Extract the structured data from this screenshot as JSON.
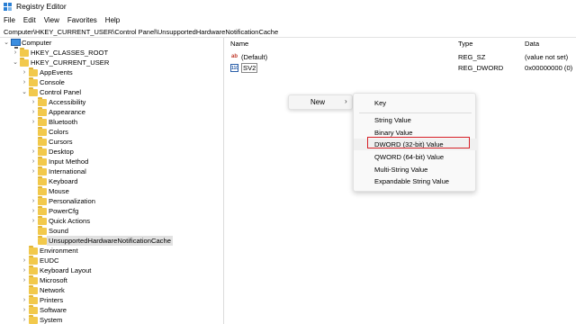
{
  "window": {
    "title": "Registry Editor"
  },
  "menu": [
    "File",
    "Edit",
    "View",
    "Favorites",
    "Help"
  ],
  "address": "Computer\\HKEY_CURRENT_USER\\Control Panel\\UnsupportedHardwareNotificationCache",
  "tree": [
    {
      "label": "Computer",
      "chev": "⌄",
      "icon": "pc",
      "depth": 0
    },
    {
      "label": "HKEY_CLASSES_ROOT",
      "chev": "›",
      "icon": "folder",
      "depth": 1
    },
    {
      "label": "HKEY_CURRENT_USER",
      "chev": "⌄",
      "icon": "folder",
      "depth": 1
    },
    {
      "label": "AppEvents",
      "chev": "›",
      "icon": "folder",
      "depth": 2
    },
    {
      "label": "Console",
      "chev": "›",
      "icon": "folder",
      "depth": 2
    },
    {
      "label": "Control Panel",
      "chev": "⌄",
      "icon": "folder",
      "depth": 2
    },
    {
      "label": "Accessibility",
      "chev": "›",
      "icon": "folder",
      "depth": 3
    },
    {
      "label": "Appearance",
      "chev": "›",
      "icon": "folder",
      "depth": 3
    },
    {
      "label": "Bluetooth",
      "chev": "›",
      "icon": "folder",
      "depth": 3
    },
    {
      "label": "Colors",
      "chev": "",
      "icon": "folder",
      "depth": 3
    },
    {
      "label": "Cursors",
      "chev": "",
      "icon": "folder",
      "depth": 3
    },
    {
      "label": "Desktop",
      "chev": "›",
      "icon": "folder",
      "depth": 3
    },
    {
      "label": "Input Method",
      "chev": "›",
      "icon": "folder",
      "depth": 3
    },
    {
      "label": "International",
      "chev": "›",
      "icon": "folder",
      "depth": 3
    },
    {
      "label": "Keyboard",
      "chev": "",
      "icon": "folder",
      "depth": 3
    },
    {
      "label": "Mouse",
      "chev": "",
      "icon": "folder",
      "depth": 3
    },
    {
      "label": "Personalization",
      "chev": "›",
      "icon": "folder",
      "depth": 3
    },
    {
      "label": "PowerCfg",
      "chev": "›",
      "icon": "folder",
      "depth": 3
    },
    {
      "label": "Quick Actions",
      "chev": "›",
      "icon": "folder",
      "depth": 3
    },
    {
      "label": "Sound",
      "chev": "",
      "icon": "folder",
      "depth": 3
    },
    {
      "label": "UnsupportedHardwareNotificationCache",
      "chev": "",
      "icon": "folder",
      "depth": 3,
      "selected": true
    },
    {
      "label": "Environment",
      "chev": "",
      "icon": "folder",
      "depth": 2
    },
    {
      "label": "EUDC",
      "chev": "›",
      "icon": "folder",
      "depth": 2
    },
    {
      "label": "Keyboard Layout",
      "chev": "›",
      "icon": "folder",
      "depth": 2
    },
    {
      "label": "Microsoft",
      "chev": "›",
      "icon": "folder",
      "depth": 2
    },
    {
      "label": "Network",
      "chev": "",
      "icon": "folder",
      "depth": 2
    },
    {
      "label": "Printers",
      "chev": "›",
      "icon": "folder",
      "depth": 2
    },
    {
      "label": "Software",
      "chev": "›",
      "icon": "folder",
      "depth": 2
    },
    {
      "label": "System",
      "chev": "›",
      "icon": "folder",
      "depth": 2
    }
  ],
  "list": {
    "headers": {
      "name": "Name",
      "type": "Type",
      "data": "Data"
    },
    "rows": [
      {
        "icon": "ab",
        "icon_name": "string-value-icon",
        "name": "(Default)",
        "type": "REG_SZ",
        "data": "(value not set)"
      },
      {
        "icon": "110",
        "icon_name": "dword-value-icon",
        "name": "SV2",
        "type": "REG_DWORD",
        "data": "0x00000000 (0)",
        "boxed": true
      }
    ]
  },
  "context": {
    "new_label": "New",
    "new_arrow": "›",
    "submenu": [
      "Key",
      "String Value",
      "Binary Value",
      "DWORD (32-bit) Value",
      "QWORD (64-bit) Value",
      "Multi-String Value",
      "Expandable String Value"
    ],
    "highlight": "DWORD (32-bit) Value",
    "highlight_color": "#d61f26"
  }
}
